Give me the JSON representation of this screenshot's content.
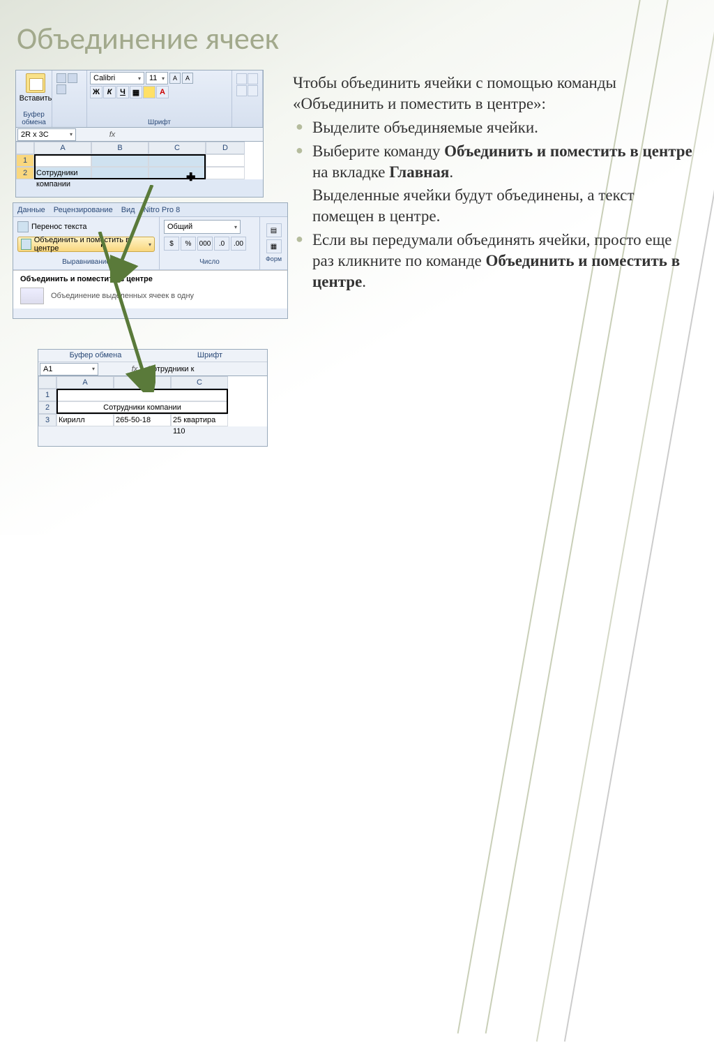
{
  "slide": {
    "title": "Объединение ячеек"
  },
  "text": {
    "intro": "Чтобы объединить ячейки с помощью команды «Объединить и поместить в центре»:",
    "b1": "Выделите объединяемые ячейки.",
    "b2_a": "Выберите команду ",
    "b2_b": "Объединить и поместить в центре",
    "b2_c": " на вкладке ",
    "b2_d": "Главная",
    "b2_e": ".",
    "p3": "Выделенные ячейки будут объединены, а текст помещен в центре.",
    "b4_a": "Если вы передумали объединять ячейки, просто еще раз кликните по команде ",
    "b4_b": "Объединить и поместить в центре",
    "b4_c": "."
  },
  "ss1": {
    "paste_label": "Вставить",
    "clipboard_caption": "Буфер обмена",
    "font_name": "Calibri",
    "font_size": "11",
    "font_caption": "Шрифт",
    "bold": "Ж",
    "italic": "К",
    "underline": "Ч",
    "name_box": "2R x 3C",
    "fx": "fx",
    "cols": {
      "a": "A",
      "b": "B",
      "c": "C",
      "d": "D"
    },
    "rows": {
      "r1": "1",
      "r2": "2"
    },
    "cell_a2": "Сотрудники компании"
  },
  "ss2": {
    "tabs": {
      "data": "Данные",
      "review": "Рецензирование",
      "view": "Вид",
      "nitro": "Nitro Pro 8"
    },
    "wrap_text": "Перенос текста",
    "merge_center": "Объединить и поместить в центре",
    "align_caption": "Выравнивание",
    "number_format": "Общий",
    "number_caption": "Число",
    "pct": "%",
    "comma": "000",
    "fmt_caption": "Форм",
    "tooltip_title": "Объединить и поместить в центре",
    "tooltip_desc": "Объединение выделенных ячеек в одну"
  },
  "ss3": {
    "clipboard_caption": "Буфер обмена",
    "font_caption": "Шрифт",
    "name_box": "A1",
    "fx": "fx",
    "fbar_value": "Сотрудники к",
    "cols": {
      "a": "A",
      "b": "B",
      "c": "C"
    },
    "rows": {
      "r1": "1",
      "r2": "2",
      "r3": "3"
    },
    "merged_text": "Сотрудники компании",
    "r3_a": "Кирилл",
    "r3_b": "265-50-18",
    "r3_c": "25 квартира 110"
  }
}
